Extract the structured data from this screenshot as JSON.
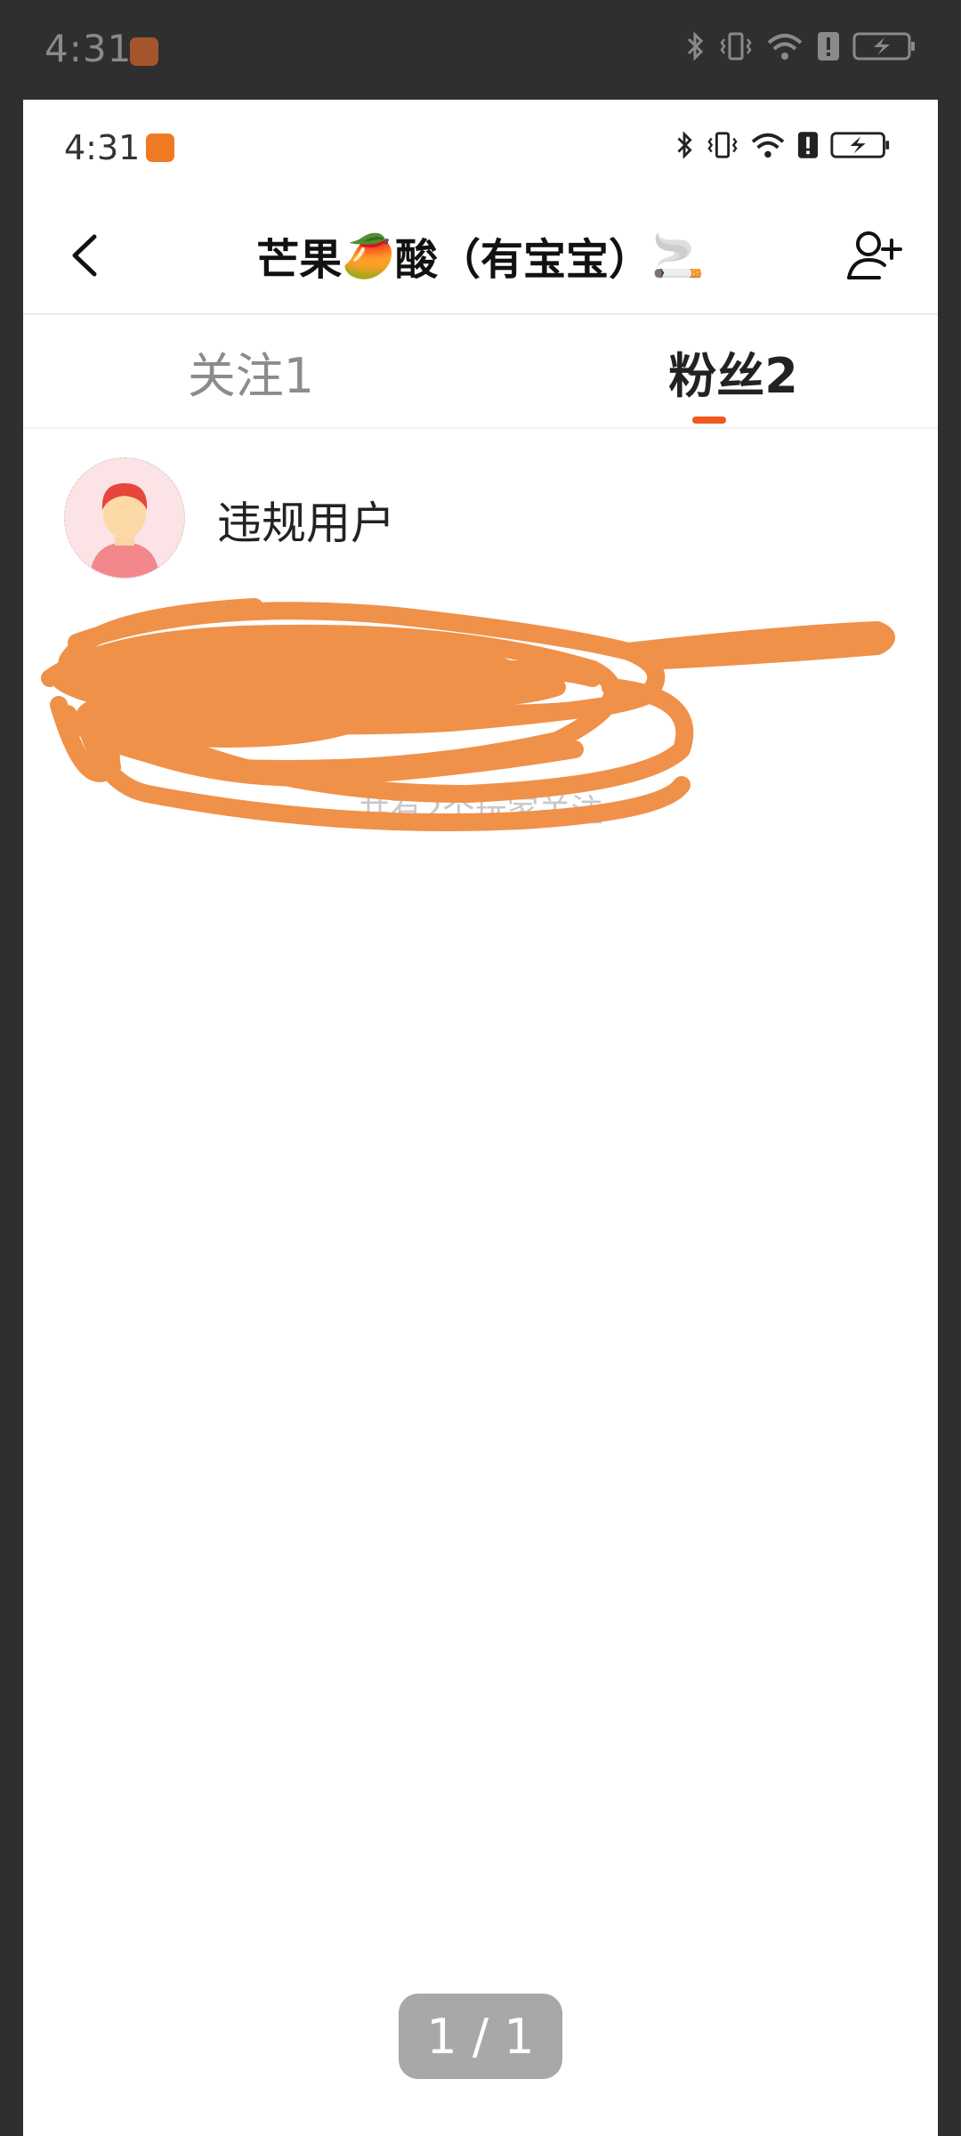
{
  "outer_status": {
    "time": "4:31"
  },
  "inner_status": {
    "time": "4:31"
  },
  "header": {
    "title_part1": "芒果",
    "title_part2": "酸（有宝宝）",
    "mango_emoji": "🥭",
    "cigarette_emoji": "🚬"
  },
  "tabs": [
    {
      "label": "关注1",
      "active": false
    },
    {
      "label": "粉丝2",
      "active": true
    }
  ],
  "list": [
    {
      "name": "违规用户"
    }
  ],
  "summary": "共有2个玩家关注",
  "pager": "1 / 1",
  "colors": {
    "accent": "#f05a1a",
    "scribble": "#f0914a",
    "background": "#2f2f2f"
  },
  "icons": {
    "back": "chevron-left-icon",
    "add_user": "add-user-icon",
    "bluetooth": "bluetooth-icon",
    "vibrate": "vibrate-icon",
    "wifi": "wifi-icon",
    "alert": "alert-icon",
    "battery": "battery-charging-icon"
  }
}
